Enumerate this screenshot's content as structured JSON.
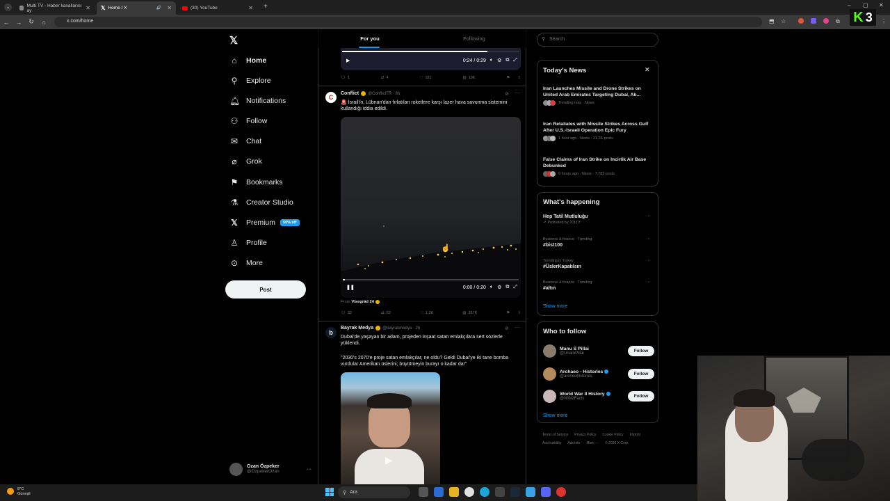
{
  "browser": {
    "tabs": [
      {
        "title": "Multi TV - Haber kanallarını ay"
      },
      {
        "title": "Home / X"
      },
      {
        "title": "(30) YouTube"
      }
    ],
    "url": "x.com/home",
    "badge": "K 3"
  },
  "nav": {
    "items": [
      {
        "label": "Home",
        "icon": "home-icon"
      },
      {
        "label": "Explore",
        "icon": "search-icon"
      },
      {
        "label": "Notifications",
        "icon": "bell-icon"
      },
      {
        "label": "Follow",
        "icon": "add-person-icon"
      },
      {
        "label": "Chat",
        "icon": "mail-icon"
      },
      {
        "label": "Grok",
        "icon": "grok-icon"
      },
      {
        "label": "Bookmarks",
        "icon": "bookmark-icon"
      },
      {
        "label": "Creator Studio",
        "icon": "flask-icon"
      },
      {
        "label": "Premium",
        "icon": "x-icon"
      },
      {
        "label": "Profile",
        "icon": "person-icon"
      },
      {
        "label": "More",
        "icon": "more-circle-icon"
      }
    ],
    "premium_badge": "50% off",
    "post_label": "Post"
  },
  "account": {
    "name": "Ozan Özpeker",
    "handle": "@OzpekerOzan",
    "more": "···"
  },
  "feed": {
    "tabs": [
      "For you",
      "Following"
    ],
    "top_video": {
      "time": "0:24 / 0:29"
    },
    "top_actions": {
      "reply": "1",
      "retweet": "4",
      "like": "181",
      "views": "19K"
    },
    "tweet1": {
      "name": "Conflict",
      "handle": "@ConflictTR · 8h",
      "text": "🚨 İsrail'in, Lübnan'dan fırlatılan roketlere karşı lazer hava savunma sistemini kullandığı iddia edildi.",
      "video_time": "0:00 / 0:20",
      "from_label": "From",
      "from": "Visegrád 24",
      "actions": {
        "reply": "32",
        "retweet": "52",
        "like": "1,2K",
        "views": "357K"
      }
    },
    "tweet2": {
      "name": "Bayrak Medya",
      "handle": "@bayrakmedya · 2h",
      "text1": "Dubai'de yaşayan bir adam, projeden inşaat satan emlakçılara sert sözlerle yüklendi.",
      "text2": "\"2030's 2070'e proje satan emlakçılar, ne oldu? Geldi Dubai'ye iki tane bomba vurdular Amerikan üslerini; büyütmeyin burayı o kadar da!\""
    }
  },
  "right": {
    "search_placeholder": "Search",
    "news": {
      "title": "Today's News",
      "items": [
        {
          "title": "Iran Launches Missile and Drone Strikes on United Arab Emirates Targeting Dubai, Ab...",
          "meta": "Trending now · News"
        },
        {
          "title": "Iran Retaliates with Missile Strikes Across Gulf After U.S.-Israeli Operation Epic Fury",
          "meta": "1 hour ago · News · 21,2K posts"
        },
        {
          "title": "False Claims of Iran Strike on Incirlik Air Base Debunked",
          "meta": "9 hours ago · News · 7,783 posts"
        }
      ]
    },
    "happening": {
      "title": "What's happening",
      "items": [
        {
          "category": "",
          "name": "Hep Tatil Mutluluğu",
          "sub": "Promoted by JOLLY"
        },
        {
          "category": "Business & finance · Trending",
          "name": "#bist100",
          "sub": ""
        },
        {
          "category": "Trending in Turkey",
          "name": "#ÜslerKapatılsın",
          "sub": ""
        },
        {
          "category": "Business & finance · Trending",
          "name": "#altın",
          "sub": ""
        }
      ],
      "show_more": "Show more"
    },
    "who_to_follow": {
      "title": "Who to follow",
      "items": [
        {
          "name": "Manu S Pillai",
          "handle": "@UnamPillai",
          "verified": false
        },
        {
          "name": "Archaeo - Histories",
          "handle": "@archeohistories",
          "verified": true
        },
        {
          "name": "World War II History",
          "handle": "@WW2Facts",
          "verified": true
        }
      ],
      "follow_label": "Follow",
      "show_more": "Show more"
    },
    "footer": [
      "Terms of Service",
      "Privacy Policy",
      "Cookie Policy",
      "Imprint",
      "Accessibility",
      "Ads info",
      "More ···",
      "© 2026 X Corp."
    ]
  },
  "taskbar": {
    "temp": "8°C",
    "weather": "Güneşli",
    "search": "Ara"
  },
  "colors": {
    "accent": "#1d9bf0",
    "bg": "#000000",
    "border": "#2f3336",
    "muted": "#71767b"
  }
}
